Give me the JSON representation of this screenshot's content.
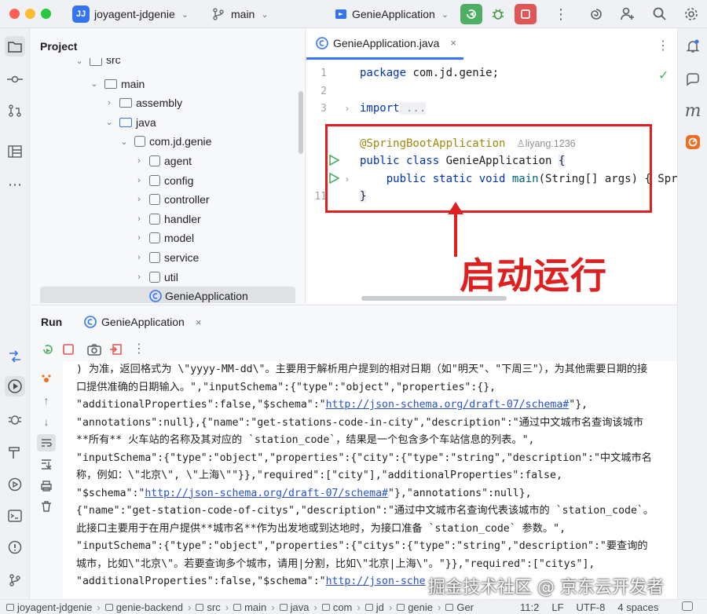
{
  "titlebar": {
    "project_badge": "JJ",
    "project_name": "joyagent-jdgenie",
    "branch": "main",
    "run_config": "GenieApplication"
  },
  "project_panel": {
    "title": "Project",
    "tree": [
      {
        "label": "src",
        "type": "folder",
        "depth": 3,
        "expanded": true
      },
      {
        "label": "main",
        "type": "folder",
        "depth": 4,
        "expanded": true
      },
      {
        "label": "assembly",
        "type": "folder",
        "depth": 5,
        "expanded": false
      },
      {
        "label": "java",
        "type": "folder",
        "depth": 5,
        "expanded": true
      },
      {
        "label": "com.jd.genie",
        "type": "package",
        "depth": 6,
        "expanded": true
      },
      {
        "label": "agent",
        "type": "package",
        "depth": 7,
        "expanded": false
      },
      {
        "label": "config",
        "type": "package",
        "depth": 7,
        "expanded": false
      },
      {
        "label": "controller",
        "type": "package",
        "depth": 7,
        "expanded": false
      },
      {
        "label": "handler",
        "type": "package",
        "depth": 7,
        "expanded": false
      },
      {
        "label": "model",
        "type": "package",
        "depth": 7,
        "expanded": false
      },
      {
        "label": "service",
        "type": "package",
        "depth": 7,
        "expanded": false
      },
      {
        "label": "util",
        "type": "package",
        "depth": 7,
        "expanded": false
      },
      {
        "label": "GenieApplication",
        "type": "class",
        "depth": 7,
        "selected": true
      }
    ]
  },
  "editor": {
    "tab_label": "GenieApplication.java",
    "line_numbers": [
      "1",
      "2",
      "3",
      "",
      "",
      "",
      "",
      "11"
    ],
    "code": {
      "package_kw": "package",
      "package_name": " com.jd.genie;",
      "import_kw": "import",
      "import_fold": " ...",
      "annotation": "@SpringBootApplication",
      "author": "liyang.1236",
      "class_line_kw": "public class",
      "class_name": " GenieApplication ",
      "class_brace": "{",
      "main_kw": "    public static void",
      "main_name": " main",
      "main_rest": "(String[] args) { Sprin",
      "close_brace": "}"
    }
  },
  "annotation_overlay": {
    "text": "启动运行"
  },
  "run_panel": {
    "title": "Run",
    "tab_label": "GenieApplication",
    "console_lines": [
      {
        "text": ") 为准，返回格式为 \\\"yyyy-MM-dd\\\"。主要用于解析用户提到的相对日期（如\"明天\"、\"下周三\"），为其他需要日期的接"
      },
      {
        "text": "口提供准确的日期输入。\",\"inputSchema\":{\"type\":\"object\",\"properties\":{},"
      },
      {
        "pre": "\"additionalProperties\":false,\"$schema\":\"",
        "link": "http://json-schema.org/draft-07/schema#",
        "post": "\"},"
      },
      {
        "text": "\"annotations\":null},{\"name\":\"get-stations-code-in-city\",\"description\":\"通过中文城市名查询该城市"
      },
      {
        "text": "**所有** 火车站的名称及其对应的 `station_code`，结果是一个包含多个车站信息的列表。\","
      },
      {
        "text": "\"inputSchema\":{\"type\":\"object\",\"properties\":{\"city\":{\"type\":\"string\",\"description\":\"中文城市名"
      },
      {
        "text": "称，例如：\\\"北京\\\", \\\"上海\\\"\"}},\"required\":[\"city\"],\"additionalProperties\":false,"
      },
      {
        "pre": "\"$schema\":\"",
        "link": "http://json-schema.org/draft-07/schema#",
        "post": "\"},\"annotations\":null},"
      },
      {
        "text": "{\"name\":\"get-station-code-of-citys\",\"description\":\"通过中文城市名查询代表该城市的 `station_code`。"
      },
      {
        "text": "此接口主要用于在用户提供**城市名**作为出发地或到达地时，为接口准备 `station_code` 参数。\","
      },
      {
        "text": "\"inputSchema\":{\"type\":\"object\",\"properties\":{\"citys\":{\"type\":\"string\",\"description\":\"要查询的"
      },
      {
        "text": "城市，比如\\\"北京\\\"。若要查询多个城市，请用|分割，比如\\\"北京|上海\\\"。\"}},\"required\":[\"citys\"],"
      },
      {
        "pre": "\"additionalProperties\":false,\"$schema\":\"",
        "link": "http://json-sche",
        "post": ""
      }
    ]
  },
  "statusbar": {
    "crumbs": [
      "joyagent-jdgenie",
      "genie-backend",
      "src",
      "main",
      "java",
      "com",
      "jd",
      "genie",
      "Ger"
    ],
    "position": "11:2",
    "line_sep": "LF",
    "encoding": "UTF-8",
    "indent": "4 spaces"
  },
  "watermark": "掘金技术社区 @ 京东云开发者"
}
